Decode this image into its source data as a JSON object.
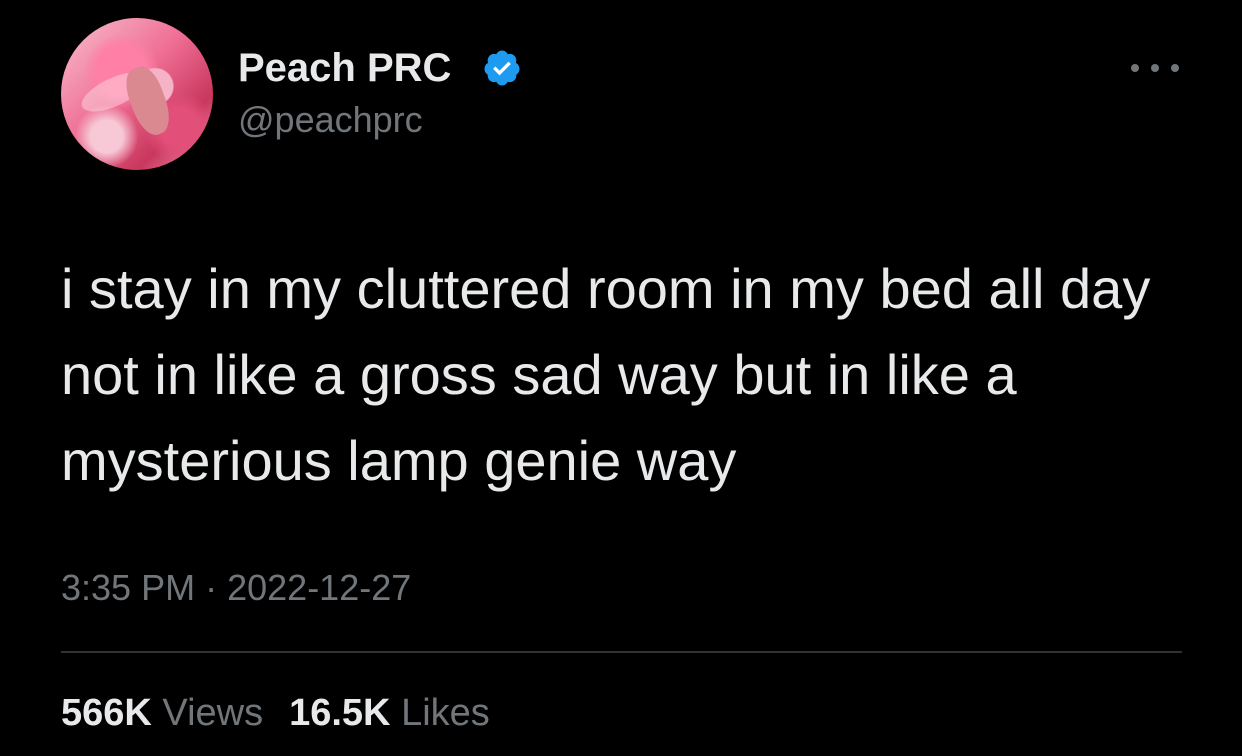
{
  "author": {
    "display_name": "Peach PRC",
    "handle": "@peachprc",
    "verified": true
  },
  "tweet": {
    "text": "i stay in my cluttered room in my bed all day not in like a gross sad way but in like a mysterious lamp genie way",
    "time": "3:35 PM",
    "separator": "·",
    "date": "2022-12-27"
  },
  "stats": {
    "views_count": "566K",
    "views_label": "Views",
    "likes_count": "16.5K",
    "likes_label": "Likes"
  },
  "icons": {
    "verified": "verified-badge-icon",
    "more": "more-options-icon"
  },
  "colors": {
    "background": "#000000",
    "text_primary": "#e7e9ea",
    "text_secondary": "#71767b",
    "verified_blue": "#1d9bf0",
    "divider": "#2f3336"
  }
}
